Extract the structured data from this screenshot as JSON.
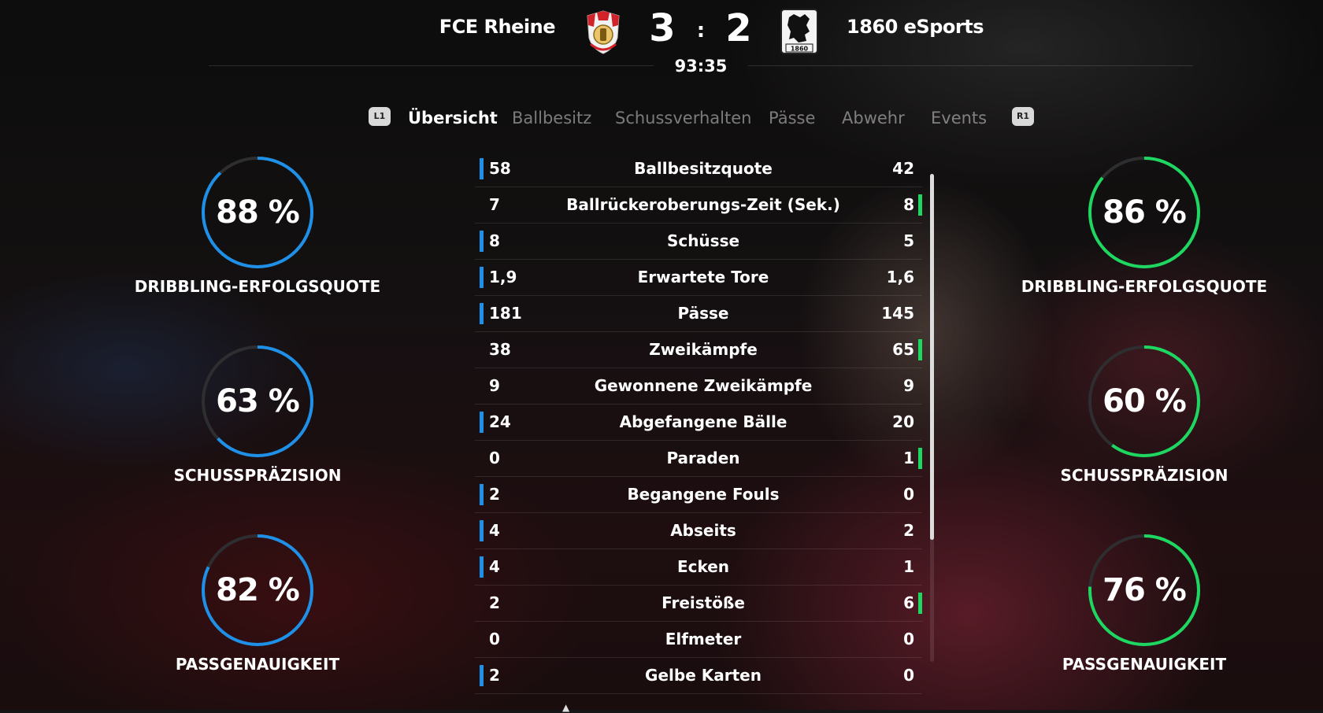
{
  "match": {
    "home_team": "FCE Rheine",
    "away_team": "1860 eSports",
    "home_score": "3",
    "away_score": "2",
    "separator": ":",
    "clock": "93:35",
    "away_crest_text": "1860"
  },
  "tabs": {
    "prev_hint": "L1",
    "next_hint": "R1",
    "items": [
      "Übersicht",
      "Ballbesitz",
      "Schussverhalten",
      "Pässe",
      "Abwehr",
      "Events"
    ],
    "active": "Übersicht"
  },
  "home_gauges": [
    {
      "value": "88 %",
      "label": "DRIBBLING-ERFOLGSQUOTE",
      "percent": 88
    },
    {
      "value": "63 %",
      "label": "SCHUSSPRÄZISION",
      "percent": 63
    },
    {
      "value": "82 %",
      "label": "PASSGENAUIGKEIT",
      "percent": 82
    }
  ],
  "away_gauges": [
    {
      "value": "86 %",
      "label": "DRIBBLING-ERFOLGSQUOTE",
      "percent": 86
    },
    {
      "value": "60 %",
      "label": "SCHUSSPRÄZISION",
      "percent": 60
    },
    {
      "value": "76 %",
      "label": "PASSGENAUIGKEIT",
      "percent": 76
    }
  ],
  "colors": {
    "home_accent": "#1e90e8",
    "away_accent": "#1ed760"
  },
  "stats": [
    {
      "home": "58",
      "label": "Ballbesitzquote",
      "away": "42",
      "leader": "home"
    },
    {
      "home": "7",
      "label": "Ballrückeroberungs-Zeit (Sek.)",
      "away": "8",
      "leader": "away"
    },
    {
      "home": "8",
      "label": "Schüsse",
      "away": "5",
      "leader": "home"
    },
    {
      "home": "1,9",
      "label": "Erwartete Tore",
      "away": "1,6",
      "leader": "home"
    },
    {
      "home": "181",
      "label": "Pässe",
      "away": "145",
      "leader": "home"
    },
    {
      "home": "38",
      "label": "Zweikämpfe",
      "away": "65",
      "leader": "away"
    },
    {
      "home": "9",
      "label": "Gewonnene Zweikämpfe",
      "away": "9",
      "leader": "none"
    },
    {
      "home": "24",
      "label": "Abgefangene Bälle",
      "away": "20",
      "leader": "home"
    },
    {
      "home": "0",
      "label": "Paraden",
      "away": "1",
      "leader": "away"
    },
    {
      "home": "2",
      "label": "Begangene Fouls",
      "away": "0",
      "leader": "home"
    },
    {
      "home": "4",
      "label": "Abseits",
      "away": "2",
      "leader": "home"
    },
    {
      "home": "4",
      "label": "Ecken",
      "away": "1",
      "leader": "home"
    },
    {
      "home": "2",
      "label": "Freistöße",
      "away": "6",
      "leader": "away"
    },
    {
      "home": "0",
      "label": "Elfmeter",
      "away": "0",
      "leader": "none"
    },
    {
      "home": "2",
      "label": "Gelbe Karten",
      "away": "0",
      "leader": "home"
    }
  ]
}
